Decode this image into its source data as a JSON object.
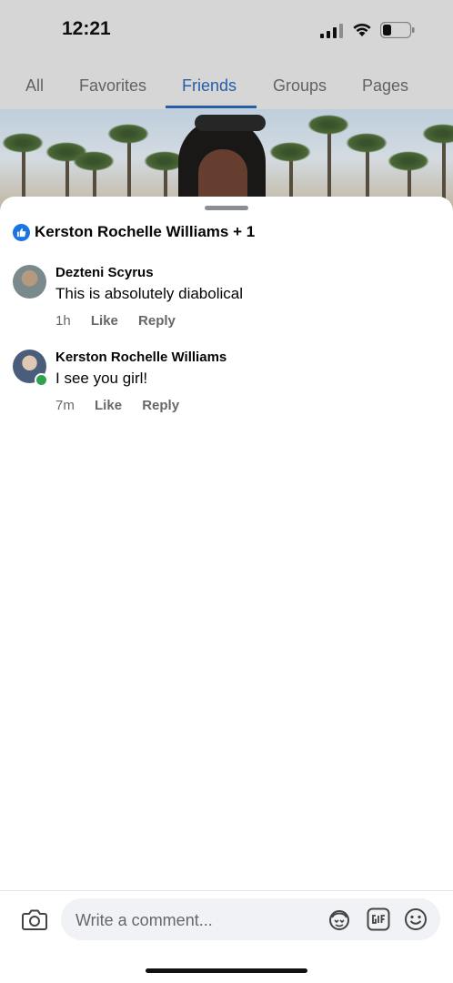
{
  "status_bar": {
    "time": "12:21"
  },
  "tabs": [
    {
      "label": "All"
    },
    {
      "label": "Favorites"
    },
    {
      "label": "Friends",
      "active": true
    },
    {
      "label": "Groups"
    },
    {
      "label": "Pages"
    }
  ],
  "reactions": {
    "summary": "Kerston Rochelle Williams + 1",
    "icon": "like-icon"
  },
  "comments": [
    {
      "author": "Dezteni Scyrus",
      "text": "This is absolutely diabolical",
      "time": "1h",
      "like_label": "Like",
      "reply_label": "Reply",
      "online": false
    },
    {
      "author": "Kerston Rochelle Williams",
      "text": "I see you girl!",
      "time": "7m",
      "like_label": "Like",
      "reply_label": "Reply",
      "online": true
    }
  ],
  "composer": {
    "placeholder": "Write a comment..."
  },
  "colors": {
    "accent": "#2a66b4",
    "like_blue": "#1b74e4",
    "online_green": "#31a24c",
    "meta_gray": "#65676b"
  }
}
